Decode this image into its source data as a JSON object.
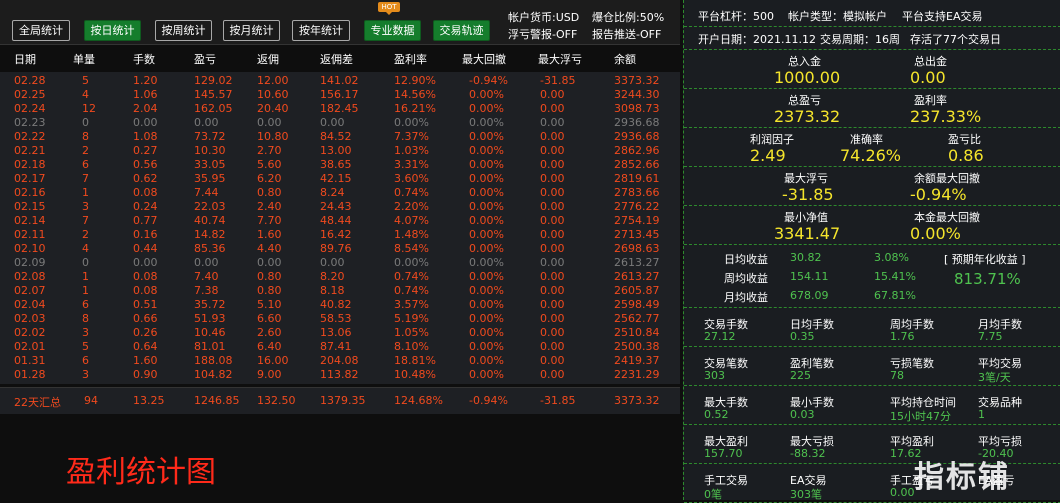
{
  "toolbar": {
    "buttons": [
      "全局统计",
      "按日统计",
      "按周统计",
      "按月统计",
      "按年统计",
      "专业数据",
      "交易轨迹"
    ],
    "hot_badge": "HOT",
    "account_currency": "帐户货币:USD",
    "margin_ratio": "爆仓比例:50%",
    "float_alert": "浮亏警报-OFF",
    "report_push": "报告推送-OFF"
  },
  "table": {
    "headers": [
      "日期",
      "单量",
      "手数",
      "盈亏",
      "返佣",
      "返佣差",
      "盈利率",
      "最大回撤",
      "最大浮亏",
      "余额"
    ],
    "rows": [
      [
        "02.28",
        "5",
        "1.20",
        "129.02",
        "12.00",
        "141.02",
        "12.90%",
        "-0.94%",
        "-31.85",
        "3373.32"
      ],
      [
        "02.25",
        "4",
        "1.06",
        "145.57",
        "10.60",
        "156.17",
        "14.56%",
        "0.00%",
        "0.00",
        "3244.30"
      ],
      [
        "02.24",
        "12",
        "2.04",
        "162.05",
        "20.40",
        "182.45",
        "16.21%",
        "0.00%",
        "0.00",
        "3098.73"
      ],
      [
        "02.23",
        "0",
        "0.00",
        "0.00",
        "0.00",
        "0.00",
        "0.00%",
        "0.00%",
        "0.00",
        "2936.68"
      ],
      [
        "02.22",
        "8",
        "1.08",
        "73.72",
        "10.80",
        "84.52",
        "7.37%",
        "0.00%",
        "0.00",
        "2936.68"
      ],
      [
        "02.21",
        "2",
        "0.27",
        "10.30",
        "2.70",
        "13.00",
        "1.03%",
        "0.00%",
        "0.00",
        "2862.96"
      ],
      [
        "02.18",
        "6",
        "0.56",
        "33.05",
        "5.60",
        "38.65",
        "3.31%",
        "0.00%",
        "0.00",
        "2852.66"
      ],
      [
        "02.17",
        "7",
        "0.62",
        "35.95",
        "6.20",
        "42.15",
        "3.60%",
        "0.00%",
        "0.00",
        "2819.61"
      ],
      [
        "02.16",
        "1",
        "0.08",
        "7.44",
        "0.80",
        "8.24",
        "0.74%",
        "0.00%",
        "0.00",
        "2783.66"
      ],
      [
        "02.15",
        "3",
        "0.24",
        "22.03",
        "2.40",
        "24.43",
        "2.20%",
        "0.00%",
        "0.00",
        "2776.22"
      ],
      [
        "02.14",
        "7",
        "0.77",
        "40.74",
        "7.70",
        "48.44",
        "4.07%",
        "0.00%",
        "0.00",
        "2754.19"
      ],
      [
        "02.11",
        "2",
        "0.16",
        "14.82",
        "1.60",
        "16.42",
        "1.48%",
        "0.00%",
        "0.00",
        "2713.45"
      ],
      [
        "02.10",
        "4",
        "0.44",
        "85.36",
        "4.40",
        "89.76",
        "8.54%",
        "0.00%",
        "0.00",
        "2698.63"
      ],
      [
        "02.09",
        "0",
        "0.00",
        "0.00",
        "0.00",
        "0.00",
        "0.00%",
        "0.00%",
        "0.00",
        "2613.27"
      ],
      [
        "02.08",
        "1",
        "0.08",
        "7.40",
        "0.80",
        "8.20",
        "0.74%",
        "0.00%",
        "0.00",
        "2613.27"
      ],
      [
        "02.07",
        "1",
        "0.08",
        "7.38",
        "0.80",
        "8.18",
        "0.74%",
        "0.00%",
        "0.00",
        "2605.87"
      ],
      [
        "02.04",
        "6",
        "0.51",
        "35.72",
        "5.10",
        "40.82",
        "3.57%",
        "0.00%",
        "0.00",
        "2598.49"
      ],
      [
        "02.03",
        "8",
        "0.66",
        "51.93",
        "6.60",
        "58.53",
        "5.19%",
        "0.00%",
        "0.00",
        "2562.77"
      ],
      [
        "02.02",
        "3",
        "0.26",
        "10.46",
        "2.60",
        "13.06",
        "1.05%",
        "0.00%",
        "0.00",
        "2510.84"
      ],
      [
        "02.01",
        "5",
        "0.64",
        "81.01",
        "6.40",
        "87.41",
        "8.10%",
        "0.00%",
        "0.00",
        "2500.38"
      ],
      [
        "01.31",
        "6",
        "1.60",
        "188.08",
        "16.00",
        "204.08",
        "18.81%",
        "0.00%",
        "0.00",
        "2419.37"
      ],
      [
        "01.28",
        "3",
        "0.90",
        "104.82",
        "9.00",
        "113.82",
        "10.48%",
        "0.00%",
        "0.00",
        "2231.29"
      ]
    ],
    "summary": [
      "22天汇总",
      "94",
      "13.25",
      "1246.85",
      "132.50",
      "1379.35",
      "124.68%",
      "-0.94%",
      "-31.85",
      "3373.32"
    ]
  },
  "chart_title": "盈利统计图",
  "right": {
    "row1": [
      "平台杠杆：500",
      "帐户类型：模拟帐户",
      "平台支持EA交易"
    ],
    "row2": [
      "开户日期：2021.11.12",
      "交易周期：16周",
      "存活了77个交易日"
    ],
    "total_deposit_label": "总入金",
    "total_deposit": "1000.00",
    "total_withdraw_label": "总出金",
    "total_withdraw": "0.00",
    "total_pnl_label": "总盈亏",
    "total_pnl": "2373.32",
    "profit_rate_label": "盈利率",
    "profit_rate": "237.33%",
    "profit_factor_label": "利润因子",
    "profit_factor": "2.49",
    "accuracy_label": "准确率",
    "accuracy": "74.26%",
    "pnl_ratio_label": "盈亏比",
    "pnl_ratio": "0.86",
    "max_float_loss_label": "最大浮亏",
    "max_float_loss": "-31.85",
    "balance_max_dd_label": "余额最大回撤",
    "balance_max_dd": "-0.94%",
    "min_equity_label": "最小净值",
    "min_equity": "3341.47",
    "principal_max_dd_label": "本金最大回撤",
    "principal_max_dd": "0.00%",
    "daily_label": "日均收益",
    "daily_value": "30.82",
    "daily_pct": "3.08%",
    "weekly_label": "周均收益",
    "weekly_value": "154.11",
    "weekly_pct": "15.41%",
    "monthly_label": "月均收益",
    "monthly_value": "678.09",
    "monthly_pct": "67.81%",
    "annual_label": "[ 预期年化收益 ]",
    "annual_value": "813.71%",
    "stats": [
      [
        [
          "交易手数",
          "27.12"
        ],
        [
          "日均手数",
          "0.35"
        ],
        [
          "周均手数",
          "1.76"
        ],
        [
          "月均手数",
          "7.75"
        ]
      ],
      [
        [
          "交易笔数",
          "303"
        ],
        [
          "盈利笔数",
          "225"
        ],
        [
          "亏损笔数",
          "78"
        ],
        [
          "平均交易",
          "3笔/天"
        ]
      ],
      [
        [
          "最大手数",
          "0.52"
        ],
        [
          "最小手数",
          "0.03"
        ],
        [
          "平均持仓时间",
          "15小时47分"
        ],
        [
          "交易品种",
          "1"
        ]
      ],
      [
        [
          "最大盈利",
          "157.70"
        ],
        [
          "最大亏损",
          "-88.32"
        ],
        [
          "平均盈利",
          "17.62"
        ],
        [
          "平均亏损",
          "-20.40"
        ]
      ],
      [
        [
          "手工交易",
          "0笔"
        ],
        [
          "EA交易",
          "303笔"
        ],
        [
          "手工盈亏",
          "0.00"
        ],
        [
          "EA盈亏",
          ""
        ]
      ]
    ]
  },
  "watermark": "指标铺"
}
